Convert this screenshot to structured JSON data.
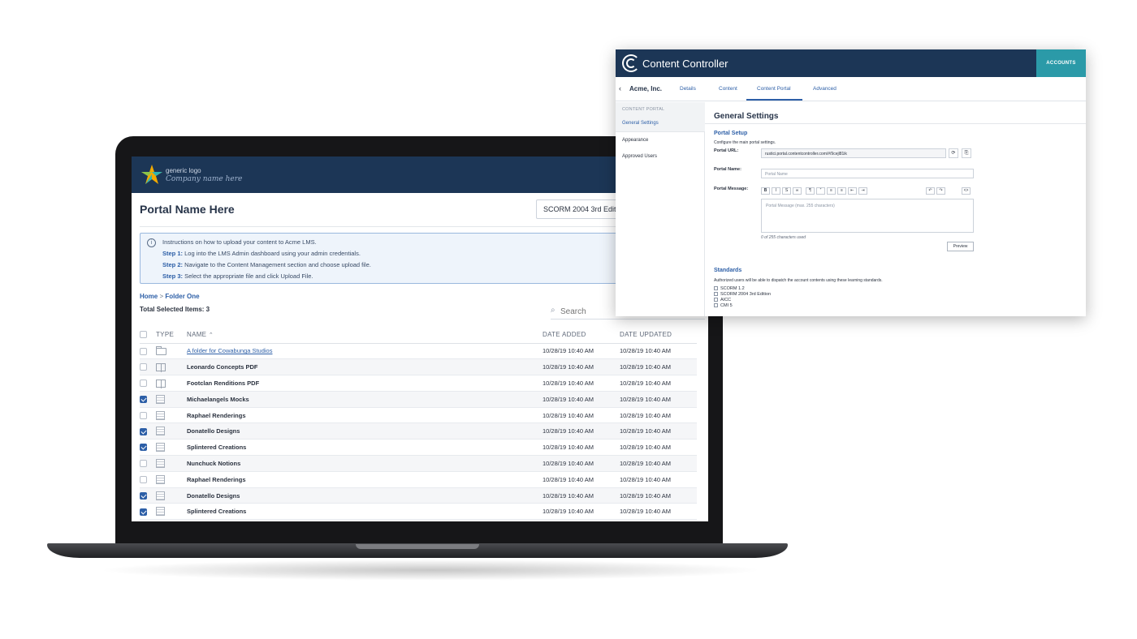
{
  "lms": {
    "logo_line1": "generic logo",
    "logo_line2": "Company name here",
    "portal_title": "Portal Name Here",
    "standard_select": "SCORM 2004 3rd Edition",
    "info": {
      "icon": "info-icon",
      "intro": "Instructions on how to upload your content to Acme LMS.",
      "steps": [
        {
          "label": "Step 1:",
          "text": " Log into the LMS Admin dashboard using your admin credentials."
        },
        {
          "label": "Step 2:",
          "text": " Navigate to the Content Management section and choose upload file."
        },
        {
          "label": "Step 3:",
          "text": " Select the appropriate file and click Upload File."
        }
      ]
    },
    "breadcrumb": {
      "home": "Home",
      "sep": " > ",
      "folder": "Folder One"
    },
    "total_selected_label": "Total Selected Items: ",
    "total_selected_count": "3",
    "search_placeholder": "Search",
    "columns": {
      "type": "TYPE",
      "name": "NAME",
      "date_added": "DATE ADDED",
      "date_updated": "DATE UPDATED"
    },
    "rows": [
      {
        "type": "folder",
        "name": "A folder for Cowabunga Studios",
        "added": "10/28/19 10:40 AM",
        "updated": "10/28/19 10:40 AM",
        "checked": false
      },
      {
        "type": "book",
        "name": "Leonardo Concepts PDF",
        "added": "10/28/19 10:40 AM",
        "updated": "10/28/19 10:40 AM",
        "checked": false
      },
      {
        "type": "book",
        "name": "Footclan Renditions PDF",
        "added": "10/28/19 10:40 AM",
        "updated": "10/28/19 10:40 AM",
        "checked": false
      },
      {
        "type": "doc",
        "name": "Michaelangels Mocks",
        "added": "10/28/19 10:40 AM",
        "updated": "10/28/19 10:40 AM",
        "checked": true
      },
      {
        "type": "doc",
        "name": "Raphael Renderings",
        "added": "10/28/19 10:40 AM",
        "updated": "10/28/19 10:40 AM",
        "checked": false
      },
      {
        "type": "doc",
        "name": "Donatello Designs",
        "added": "10/28/19 10:40 AM",
        "updated": "10/28/19 10:40 AM",
        "checked": true
      },
      {
        "type": "doc",
        "name": "Splintered Creations",
        "added": "10/28/19 10:40 AM",
        "updated": "10/28/19 10:40 AM",
        "checked": true
      },
      {
        "type": "doc",
        "name": "Nunchuck Notions",
        "added": "10/28/19 10:40 AM",
        "updated": "10/28/19 10:40 AM",
        "checked": false
      },
      {
        "type": "doc",
        "name": "Raphael Renderings",
        "added": "10/28/19 10:40 AM",
        "updated": "10/28/19 10:40 AM",
        "checked": false
      },
      {
        "type": "doc",
        "name": "Donatello Designs",
        "added": "10/28/19 10:40 AM",
        "updated": "10/28/19 10:40 AM",
        "checked": true
      },
      {
        "type": "doc",
        "name": "Splintered Creations",
        "added": "10/28/19 10:40 AM",
        "updated": "10/28/19 10:40 AM",
        "checked": true
      }
    ]
  },
  "cc": {
    "app_title": "Content Controller",
    "accounts_button": "ACCOUNTS",
    "account_name": "Acme, Inc.",
    "tabs": [
      "Details",
      "Content",
      "Content Portal",
      "Advanced"
    ],
    "active_tab": "Content Portal",
    "sidebar": {
      "heading": "CONTENT PORTAL",
      "items": [
        "General Settings",
        "Appearance",
        "Approved Users"
      ]
    },
    "general_settings_title": "General Settings",
    "portal_setup": {
      "title": "Portal Setup",
      "description": "Configure the main portal settings.",
      "url_label": "Portal URL:",
      "url_value": "rustici.portal.contentcontroller.com/#/9cejl81ik",
      "name_label": "Portal Name:",
      "name_placeholder": "Portal Name",
      "message_label": "Portal Message:",
      "message_placeholder": "Portal Message (max. 255 characters)",
      "char_count": "0 of 255 characters used",
      "preview_button": "Preview"
    },
    "standards": {
      "title": "Standards",
      "description": "Authorized users will be able to dispatch the account contents using these learning standards.",
      "items": [
        "SCORM 1.2",
        "SCORM 2004 3rd Edition",
        "AICC",
        "CMI 5"
      ]
    },
    "colors": {
      "header": "#1c3656",
      "accent": "#2d5fa7",
      "accounts": "#2b9aa8"
    }
  }
}
